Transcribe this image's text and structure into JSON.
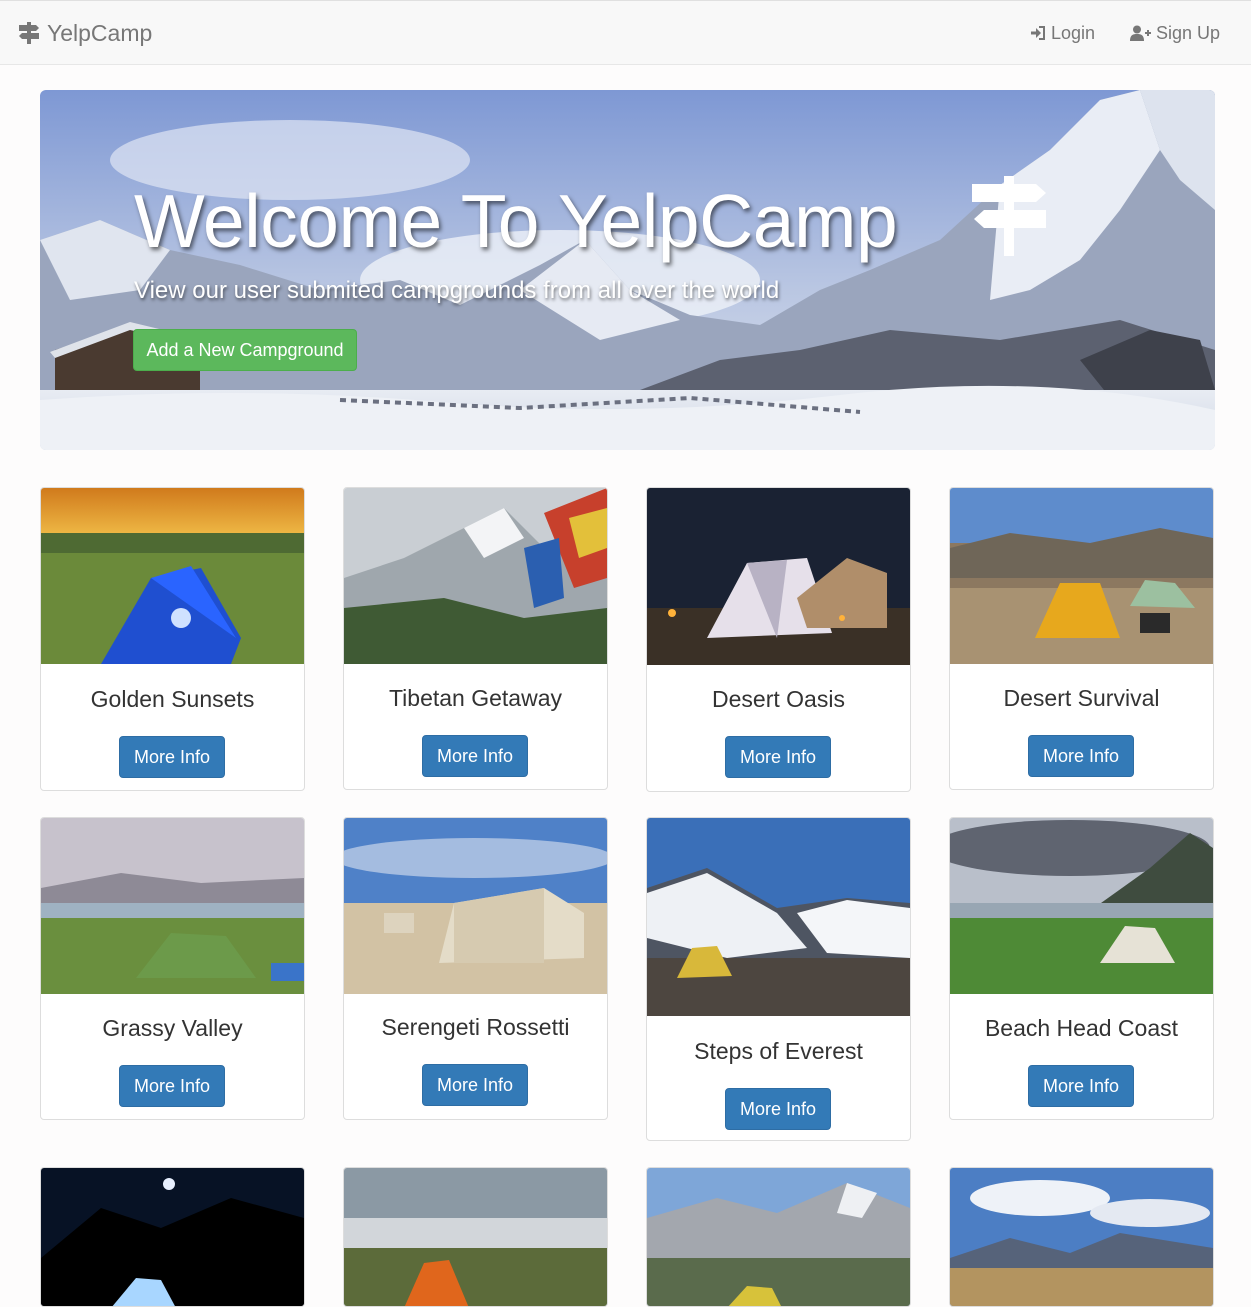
{
  "navbar": {
    "brand": "YelpCamp",
    "login_label": "Login",
    "signup_label": "Sign Up"
  },
  "jumbotron": {
    "title": "Welcome To YelpCamp",
    "subtitle": "View our user submited campgrounds from all over the world",
    "add_button": "Add a New Campground"
  },
  "campgrounds": [
    {
      "name": "Golden Sunsets",
      "button": "More Info"
    },
    {
      "name": "Tibetan Getaway",
      "button": "More Info"
    },
    {
      "name": "Desert Oasis",
      "button": "More Info"
    },
    {
      "name": "Desert Survival",
      "button": "More Info"
    },
    {
      "name": "Grassy Valley",
      "button": "More Info"
    },
    {
      "name": "Serengeti Rossetti",
      "button": "More Info"
    },
    {
      "name": "Steps of Everest",
      "button": "More Info"
    },
    {
      "name": "Beach Head Coast",
      "button": "More Info"
    }
  ],
  "icons": {
    "brand": "signpost-icon",
    "login": "sign-in-icon",
    "signup": "user-plus-icon"
  },
  "colors": {
    "success": "#5cb85c",
    "primary": "#337ab7",
    "navbar_bg": "#f8f8f8",
    "nav_text": "#777777"
  }
}
